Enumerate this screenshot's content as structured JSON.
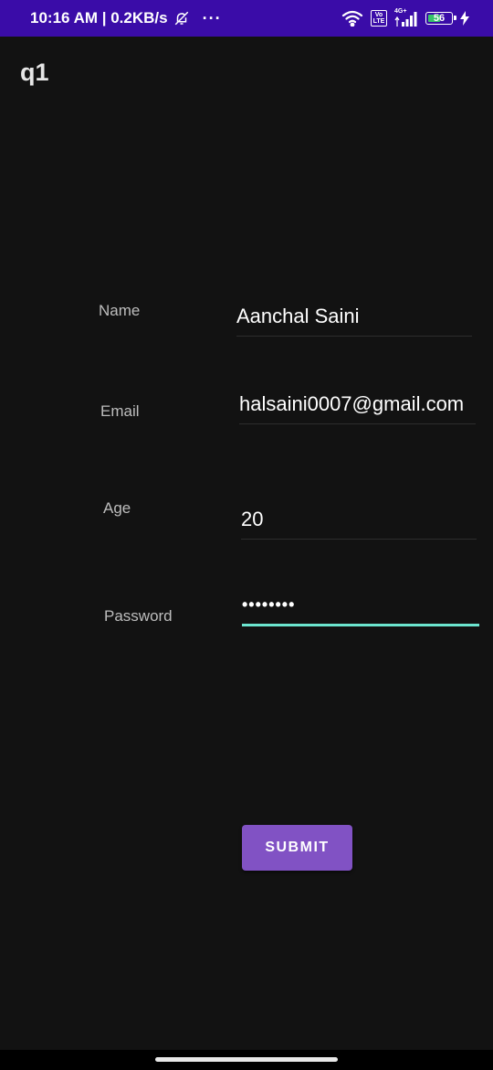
{
  "status_bar": {
    "time_speed": "10:16 AM | 0.2KB/s",
    "more": "···",
    "volte": "Vo\nLTE",
    "network": "4G+",
    "battery": "56",
    "battery_level_percent": 56,
    "icons": [
      "bell-off-icon",
      "wifi-icon",
      "volte-icon",
      "signal-icon",
      "battery-icon",
      "charging-icon"
    ]
  },
  "app": {
    "title": "q1"
  },
  "form": {
    "name": {
      "label": "Name",
      "value": "Aanchal Saini"
    },
    "email": {
      "label": "Email",
      "value": "halsaini0007@gmail.com"
    },
    "age": {
      "label": "Age",
      "value": "20"
    },
    "password": {
      "label": "Password",
      "value": "••••••••"
    }
  },
  "submit": {
    "label": "SUBMIT"
  },
  "colors": {
    "status_bar": "#3a0ca8",
    "background": "#121212",
    "accent_underline": "#6ce5cf",
    "button": "#8152c4"
  }
}
